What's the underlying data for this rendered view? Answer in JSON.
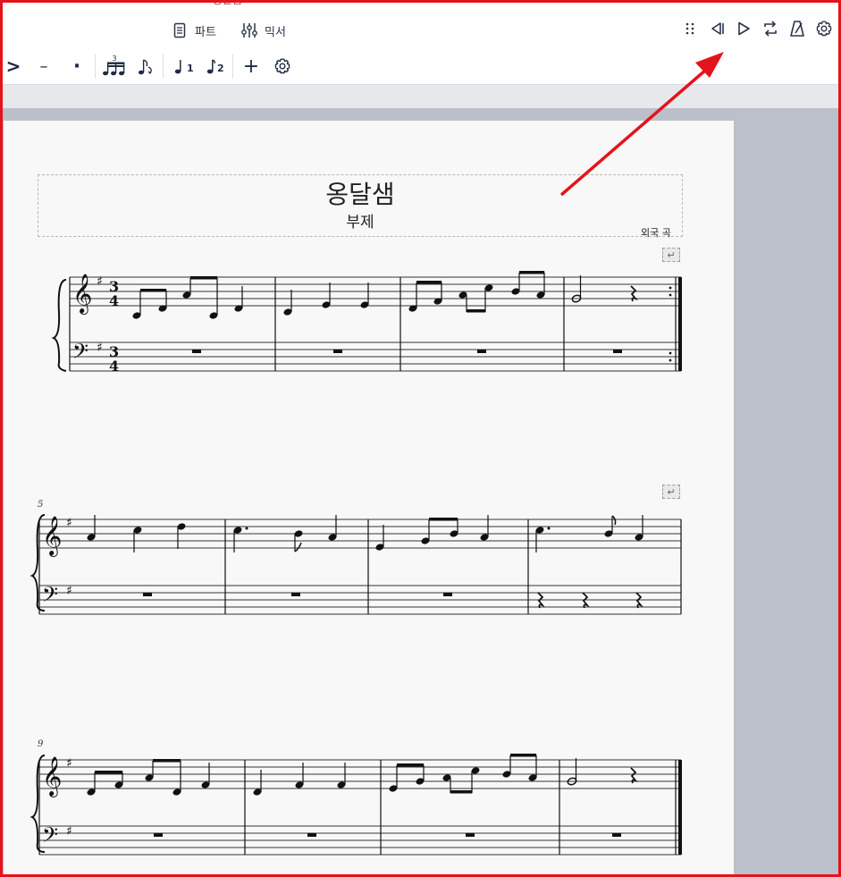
{
  "toolbar": {
    "top_cut_label": "풍을음",
    "parts_label": "파트",
    "mixer_label": "믹서",
    "parts_icon": "document-icon",
    "mixer_icon": "sliders-icon"
  },
  "playback": {
    "icons": [
      "grip-icon",
      "rewind-icon",
      "play-icon",
      "loop-icon",
      "metronome-icon",
      "settings-icon"
    ]
  },
  "notebar": {
    "accent_label": ">",
    "tenuto_label": "–",
    "staccato_label": "·",
    "tuplet_number": "3",
    "voice1_label": "1",
    "voice2_label": "2",
    "add_label": "+",
    "icons": [
      "accent-icon",
      "tenuto-icon",
      "staccato-icon",
      "tuplet-icon",
      "flip-icon",
      "voice-1-icon",
      "voice-2-icon",
      "add-icon",
      "customize-icon"
    ]
  },
  "score": {
    "title": "옹달샘",
    "subtitle": "부제",
    "composer": "외국 곡",
    "time_signature": {
      "top": "3",
      "bottom": "4"
    },
    "measure_numbers": [
      "5",
      "9"
    ]
  },
  "colors": {
    "annotation_red": "#e5131b",
    "workspace": "#bbc0cb",
    "page": "#f8f8f8",
    "icon": "#1f2a44"
  }
}
